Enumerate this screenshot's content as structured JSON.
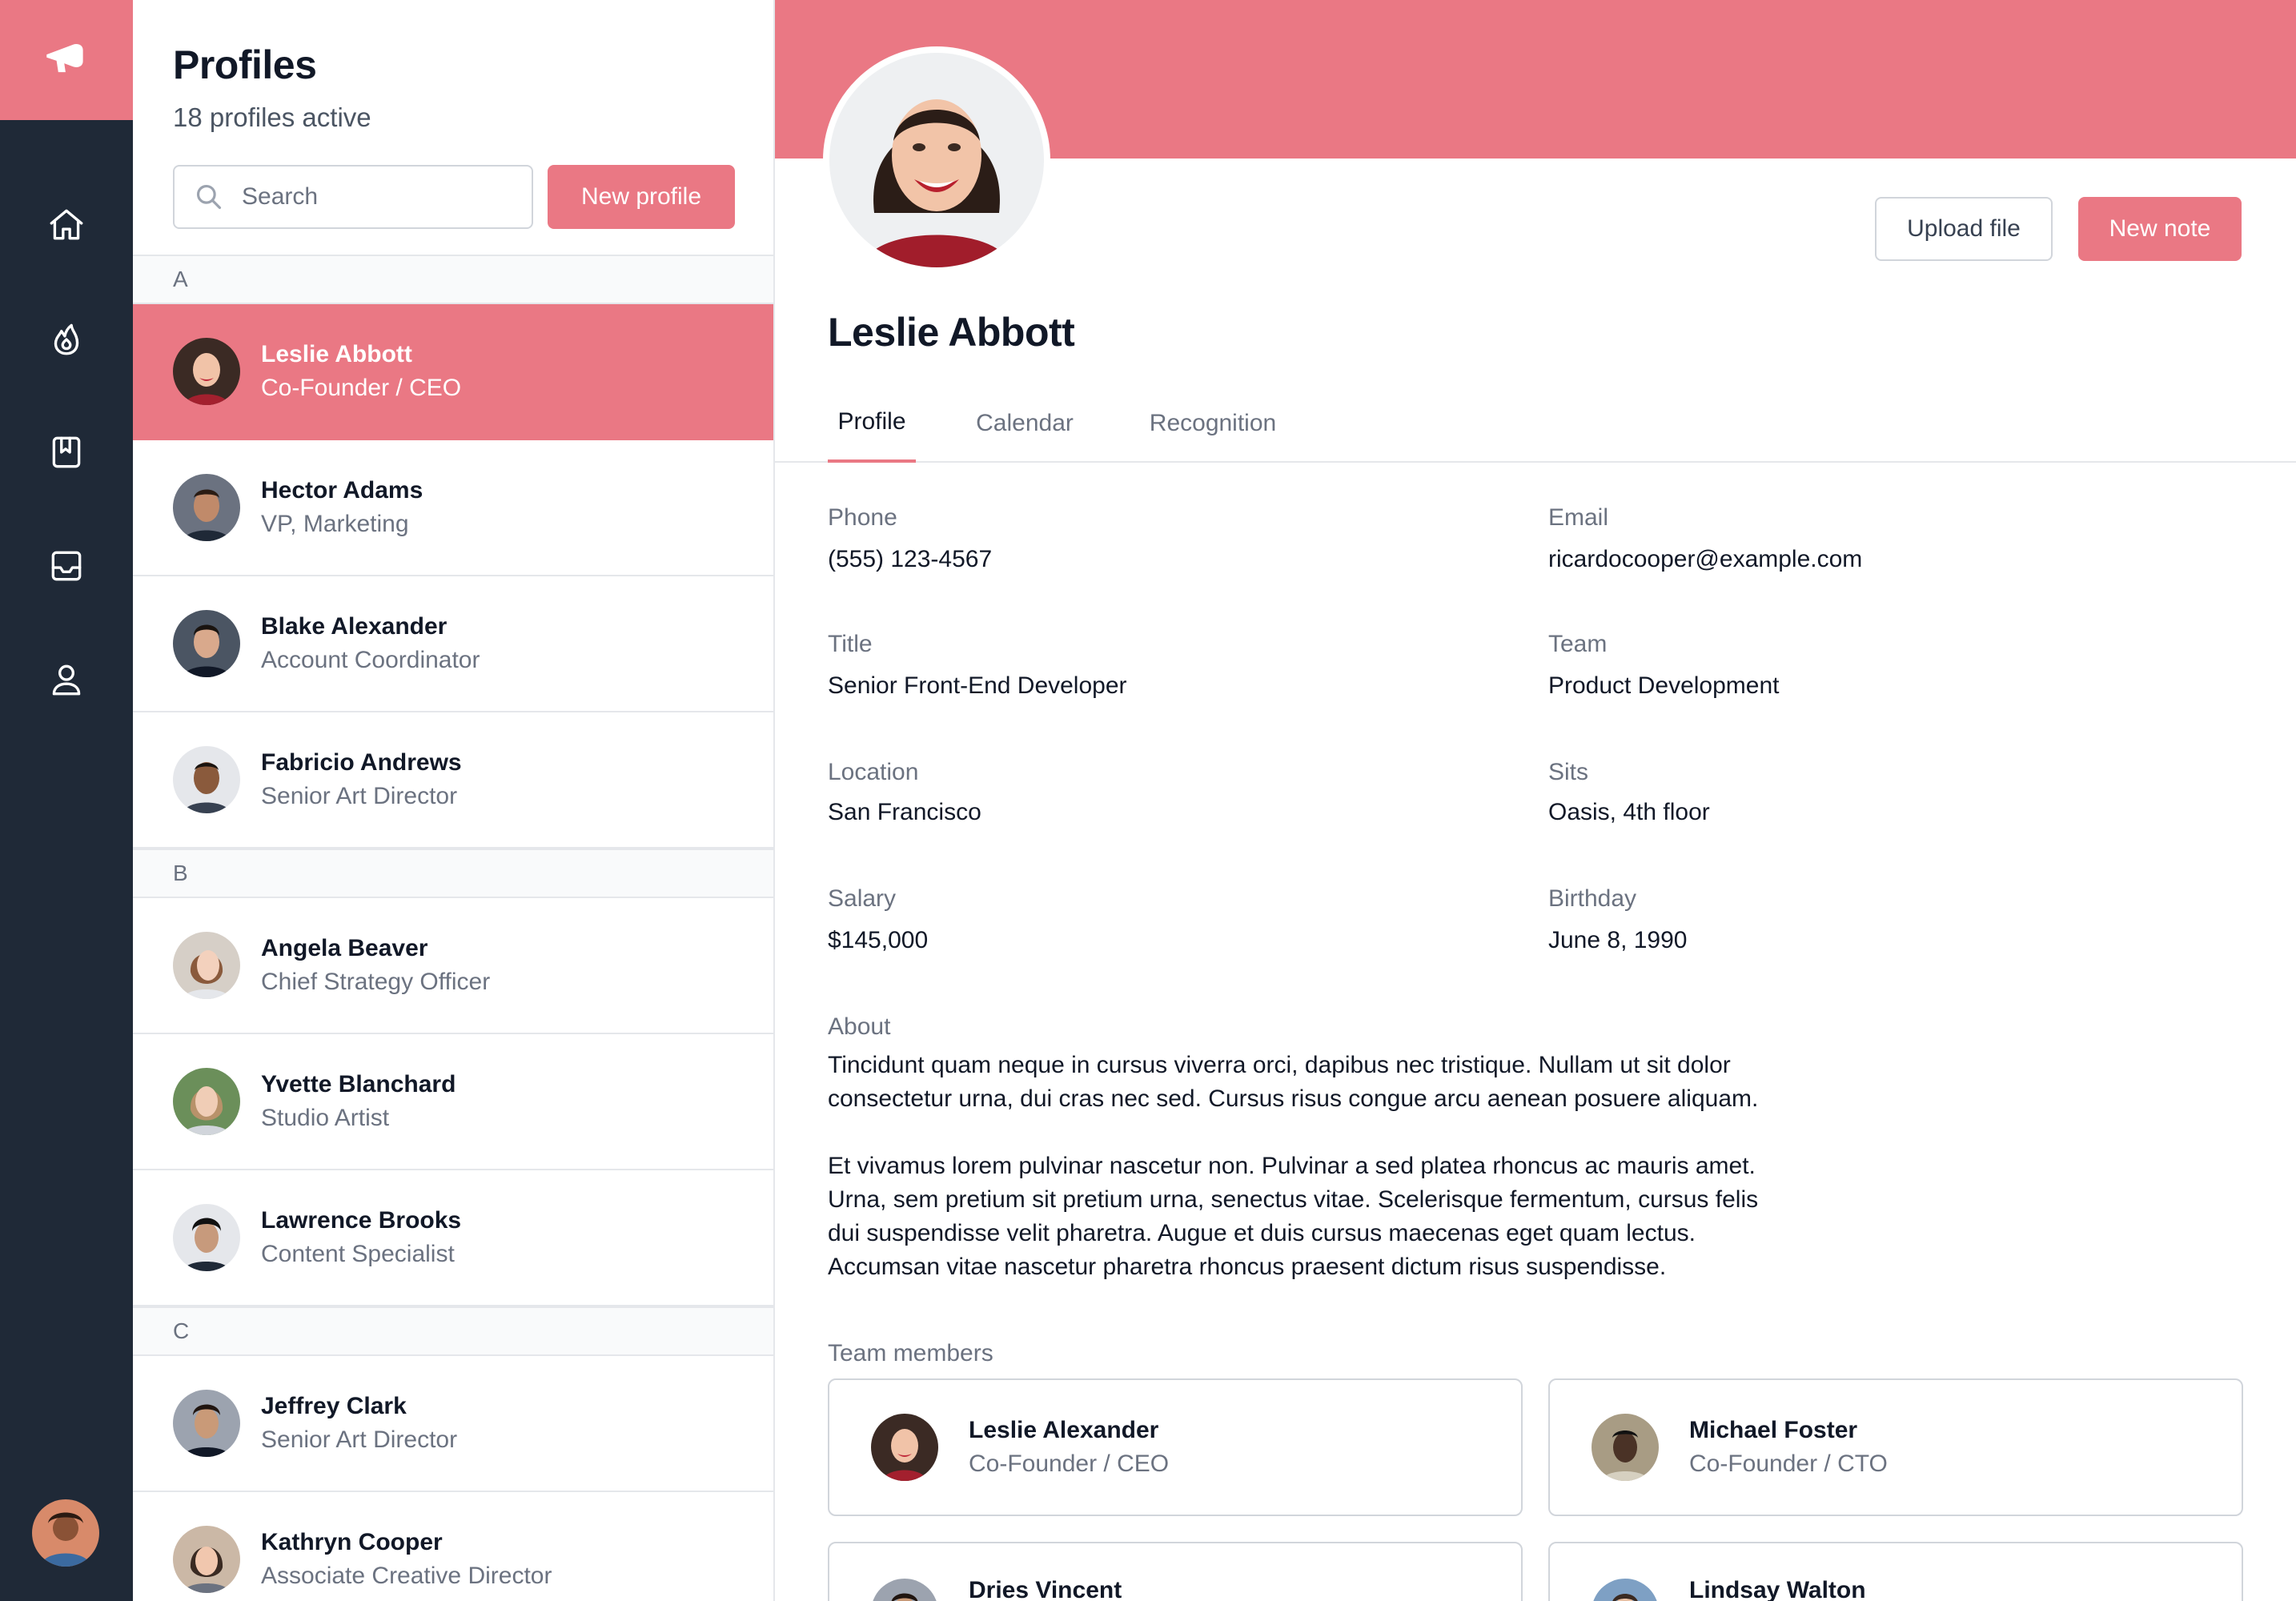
{
  "colors": {
    "accent": "#ea7884",
    "rail": "#1f2937"
  },
  "rail": {
    "logo_icon": "megaphone-icon",
    "items": [
      {
        "icon": "home-icon"
      },
      {
        "icon": "fire-icon"
      },
      {
        "icon": "bookmark-icon"
      },
      {
        "icon": "inbox-icon"
      },
      {
        "icon": "user-icon"
      }
    ]
  },
  "list": {
    "title": "Profiles",
    "subtitle": "18 profiles active",
    "search_placeholder": "Search",
    "new_profile_label": "New profile",
    "groups": [
      {
        "letter": "A",
        "people": [
          {
            "name": "Leslie Abbott",
            "role": "Co-Founder / CEO",
            "active": true
          },
          {
            "name": "Hector Adams",
            "role": "VP, Marketing"
          },
          {
            "name": "Blake Alexander",
            "role": "Account Coordinator"
          },
          {
            "name": "Fabricio Andrews",
            "role": "Senior Art Director"
          }
        ]
      },
      {
        "letter": "B",
        "people": [
          {
            "name": "Angela Beaver",
            "role": "Chief Strategy Officer"
          },
          {
            "name": "Yvette Blanchard",
            "role": "Studio Artist"
          },
          {
            "name": "Lawrence Brooks",
            "role": "Content Specialist"
          }
        ]
      },
      {
        "letter": "C",
        "people": [
          {
            "name": "Jeffrey Clark",
            "role": "Senior Art Director"
          },
          {
            "name": "Kathryn Cooper",
            "role": "Associate Creative Director"
          }
        ]
      }
    ]
  },
  "detail": {
    "name": "Leslie Abbott",
    "upload_label": "Upload file",
    "note_label": "New note",
    "tabs": [
      {
        "label": "Profile",
        "active": true
      },
      {
        "label": "Calendar"
      },
      {
        "label": "Recognition"
      }
    ],
    "fields": [
      {
        "label": "Phone",
        "value": "(555) 123-4567"
      },
      {
        "label": "Email",
        "value": "ricardocooper@example.com"
      },
      {
        "label": "Title",
        "value": "Senior Front-End Developer"
      },
      {
        "label": "Team",
        "value": "Product Development"
      },
      {
        "label": "Location",
        "value": "San Francisco"
      },
      {
        "label": "Sits",
        "value": "Oasis, 4th floor"
      },
      {
        "label": "Salary",
        "value": "$145,000"
      },
      {
        "label": "Birthday",
        "value": "June 8, 1990"
      }
    ],
    "about_label": "About",
    "about": [
      "Tincidunt quam neque in cursus viverra orci, dapibus nec tristique. Nullam ut sit dolor consectetur urna, dui cras nec sed. Cursus risus congue arcu aenean posuere aliquam.",
      "Et vivamus lorem pulvinar nascetur non. Pulvinar a sed platea rhoncus ac mauris amet. Urna, sem pretium sit pretium urna, senectus vitae. Scelerisque fermentum, cursus felis dui suspendisse velit pharetra. Augue et duis cursus maecenas eget quam lectus. Accumsan vitae nascetur pharetra rhoncus praesent dictum risus suspendisse."
    ],
    "team_label": "Team members",
    "team": [
      {
        "name": "Leslie Alexander",
        "role": "Co-Founder / CEO"
      },
      {
        "name": "Michael Foster",
        "role": "Co-Founder / CTO"
      },
      {
        "name": "Dries Vincent",
        "role": ""
      },
      {
        "name": "Lindsay Walton",
        "role": ""
      }
    ]
  }
}
